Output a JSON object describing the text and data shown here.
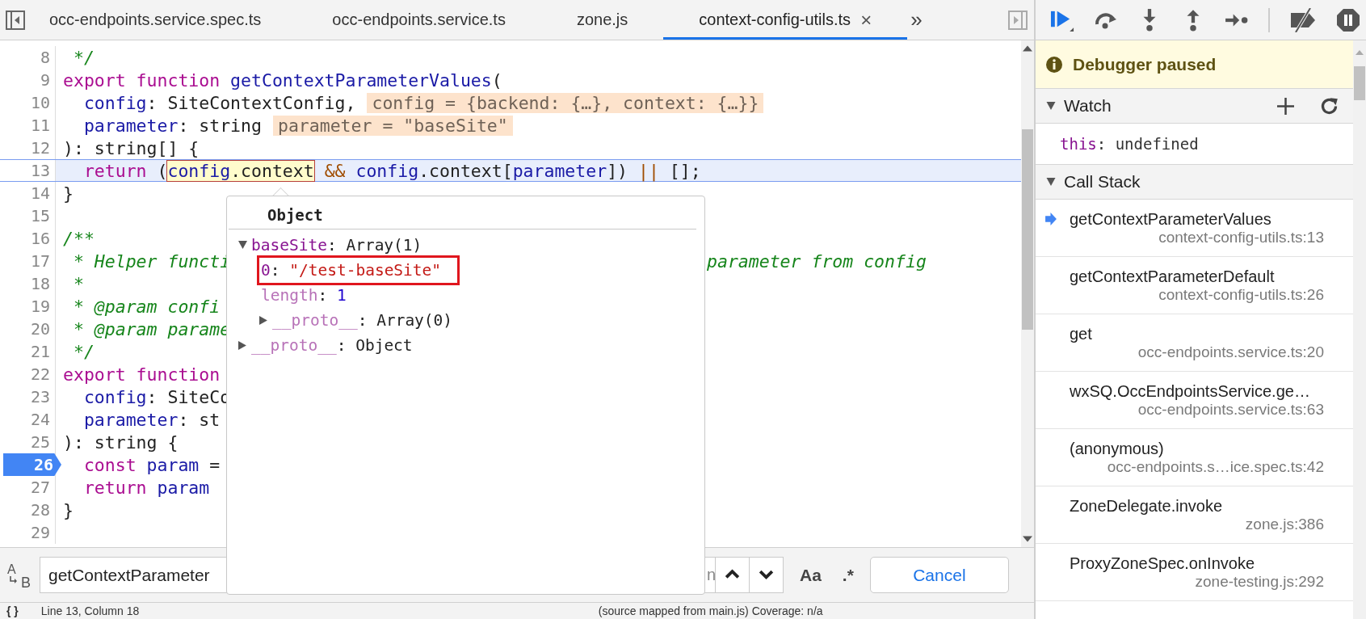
{
  "tabs": {
    "items": [
      {
        "label": "occ-endpoints.service.spec.ts",
        "selected": false
      },
      {
        "label": "occ-endpoints.service.ts",
        "selected": false
      },
      {
        "label": "zone.js",
        "selected": false
      },
      {
        "label": "context-config-utils.ts",
        "selected": true
      }
    ],
    "close": "×",
    "more": "»"
  },
  "editor": {
    "lines": [
      {
        "number": "8",
        "current": false,
        "breakpoint": false,
        "tokens": [
          {
            "kind": "comment",
            "text": " */"
          }
        ]
      },
      {
        "number": "9",
        "current": false,
        "breakpoint": false,
        "tokens": [
          {
            "kind": "kw",
            "text": "export function "
          },
          {
            "kind": "def",
            "text": "getContextParameterValues"
          },
          {
            "kind": "plain",
            "text": "("
          }
        ]
      },
      {
        "number": "10",
        "current": false,
        "breakpoint": false,
        "tokens": [
          {
            "kind": "var",
            "text": "  config"
          },
          {
            "kind": "plain",
            "text": ": SiteContextConfig,"
          },
          {
            "kind": "inline",
            "text": "config = {backend: {…}, context: {…}}"
          }
        ]
      },
      {
        "number": "11",
        "current": false,
        "breakpoint": false,
        "tokens": [
          {
            "kind": "var",
            "text": "  parameter"
          },
          {
            "kind": "plain",
            "text": ": string"
          },
          {
            "kind": "inline",
            "text": "parameter = \"baseSite\""
          }
        ]
      },
      {
        "number": "12",
        "current": false,
        "breakpoint": false,
        "tokens": [
          {
            "kind": "plain",
            "text": "): string[] {"
          }
        ]
      },
      {
        "number": "13",
        "current": true,
        "breakpoint": false,
        "tokens": [
          {
            "kind": "kw",
            "text": "  return"
          },
          {
            "kind": "plain",
            "text": " ("
          },
          {
            "kind": "hover",
            "parts": [
              {
                "kind": "var",
                "text": "config"
              },
              {
                "kind": "plain",
                "text": ".context"
              }
            ]
          },
          {
            "kind": "op",
            "text": " && "
          },
          {
            "kind": "var",
            "text": "config"
          },
          {
            "kind": "plain",
            "text": ".context["
          },
          {
            "kind": "var",
            "text": "parameter"
          },
          {
            "kind": "plain",
            "text": "]) "
          },
          {
            "kind": "op",
            "text": "||"
          },
          {
            "kind": "plain",
            "text": " [];"
          }
        ]
      },
      {
        "number": "14",
        "current": false,
        "breakpoint": false,
        "tokens": [
          {
            "kind": "plain",
            "text": "}"
          }
        ]
      },
      {
        "number": "15",
        "current": false,
        "breakpoint": false
      },
      {
        "number": "16",
        "current": false,
        "breakpoint": false,
        "tokens": [
          {
            "kind": "comment",
            "text": "/**"
          }
        ]
      },
      {
        "number": "17",
        "current": false,
        "breakpoint": false,
        "tokens": [
          {
            "kind": "comment",
            "text": " * Helper functi"
          }
        ],
        "after_popup": [
          {
            "kind": "comment",
            "text": "parameter from config"
          }
        ]
      },
      {
        "number": "18",
        "current": false,
        "breakpoint": false,
        "tokens": [
          {
            "kind": "comment",
            "text": " *"
          }
        ]
      },
      {
        "number": "19",
        "current": false,
        "breakpoint": false,
        "tokens": [
          {
            "kind": "comment",
            "text": " * @param confi"
          }
        ]
      },
      {
        "number": "20",
        "current": false,
        "breakpoint": false,
        "tokens": [
          {
            "kind": "comment",
            "text": " * @param parame"
          }
        ]
      },
      {
        "number": "21",
        "current": false,
        "breakpoint": false,
        "tokens": [
          {
            "kind": "comment",
            "text": " */"
          }
        ]
      },
      {
        "number": "22",
        "current": false,
        "breakpoint": false,
        "tokens": [
          {
            "kind": "kw",
            "text": "export function"
          }
        ]
      },
      {
        "number": "23",
        "current": false,
        "breakpoint": false,
        "tokens": [
          {
            "kind": "var",
            "text": "  config"
          },
          {
            "kind": "plain",
            "text": ": SiteCo"
          }
        ]
      },
      {
        "number": "24",
        "current": false,
        "breakpoint": false,
        "tokens": [
          {
            "kind": "var",
            "text": "  parameter"
          },
          {
            "kind": "plain",
            "text": ": st"
          }
        ]
      },
      {
        "number": "25",
        "current": false,
        "breakpoint": false,
        "tokens": [
          {
            "kind": "plain",
            "text": "): string {"
          }
        ]
      },
      {
        "number": "26",
        "current": false,
        "breakpoint": true,
        "tokens": [
          {
            "kind": "kw",
            "text": "  const "
          },
          {
            "kind": "def",
            "text": "param"
          },
          {
            "kind": "plain",
            "text": " ="
          }
        ]
      },
      {
        "number": "27",
        "current": false,
        "breakpoint": false,
        "tokens": [
          {
            "kind": "kw",
            "text": "  return "
          },
          {
            "kind": "var",
            "text": "param"
          }
        ]
      },
      {
        "number": "28",
        "current": false,
        "breakpoint": false,
        "tokens": [
          {
            "kind": "plain",
            "text": "}"
          }
        ]
      },
      {
        "number": "29",
        "current": false,
        "breakpoint": false
      }
    ]
  },
  "popover": {
    "title": "Object",
    "tree": [
      {
        "key": "baseSite",
        "internal": false,
        "sep": ": ",
        "value": "Array(1)",
        "kind": "object",
        "expanded": true,
        "highlighted": false,
        "children": [
          {
            "key": "0",
            "internal": false,
            "sep": ": ",
            "value": "\"/test-baseSite\"",
            "kind": "string",
            "highlighted": true
          },
          {
            "key": "length",
            "internal": true,
            "sep": ": ",
            "value": "1",
            "kind": "number",
            "highlighted": false
          },
          {
            "key": "__proto__",
            "internal": true,
            "sep": ": ",
            "value": "Array(0)",
            "kind": "object",
            "expanded": false,
            "highlighted": false
          }
        ]
      },
      {
        "key": "__proto__",
        "internal": true,
        "sep": ": ",
        "value": "Object",
        "kind": "object",
        "expanded": false,
        "highlighted": false
      }
    ]
  },
  "find_bar": {
    "replace_toggle": [
      "A",
      "B"
    ],
    "value": "getContextParameter",
    "match_count": "n",
    "case_toggle": "Aa",
    "regex_toggle": ".*",
    "cancel": "Cancel"
  },
  "status_bar": {
    "pretty_print": "{ }",
    "position": "Line 13, Column 18",
    "source": "(source mapped from main.js) Coverage: n/a"
  },
  "debugger": {
    "banner": "Debugger paused",
    "watch": {
      "title": "Watch",
      "expanded": true,
      "items": [
        {
          "name": "this",
          "sep": ": ",
          "value": "undefined"
        }
      ]
    },
    "call_stack": {
      "title": "Call Stack",
      "expanded": true,
      "frames": [
        {
          "name": "getContextParameterValues",
          "location": "context-config-utils.ts:13",
          "selected": true
        },
        {
          "name": "getContextParameterDefault",
          "location": "context-config-utils.ts:26",
          "selected": false
        },
        {
          "name": "get",
          "location": "occ-endpoints.service.ts:20",
          "selected": false
        },
        {
          "name": "wxSQ.OccEndpointsService.ge…",
          "location": "occ-endpoints.service.ts:63",
          "selected": false
        },
        {
          "name": "(anonymous)",
          "location": "occ-endpoints.s…ice.spec.ts:42",
          "selected": false
        },
        {
          "name": "ZoneDelegate.invoke",
          "location": "zone.js:386",
          "selected": false
        },
        {
          "name": "ProxyZoneSpec.onInvoke",
          "location": "zone-testing.js:292",
          "selected": false
        }
      ]
    }
  }
}
